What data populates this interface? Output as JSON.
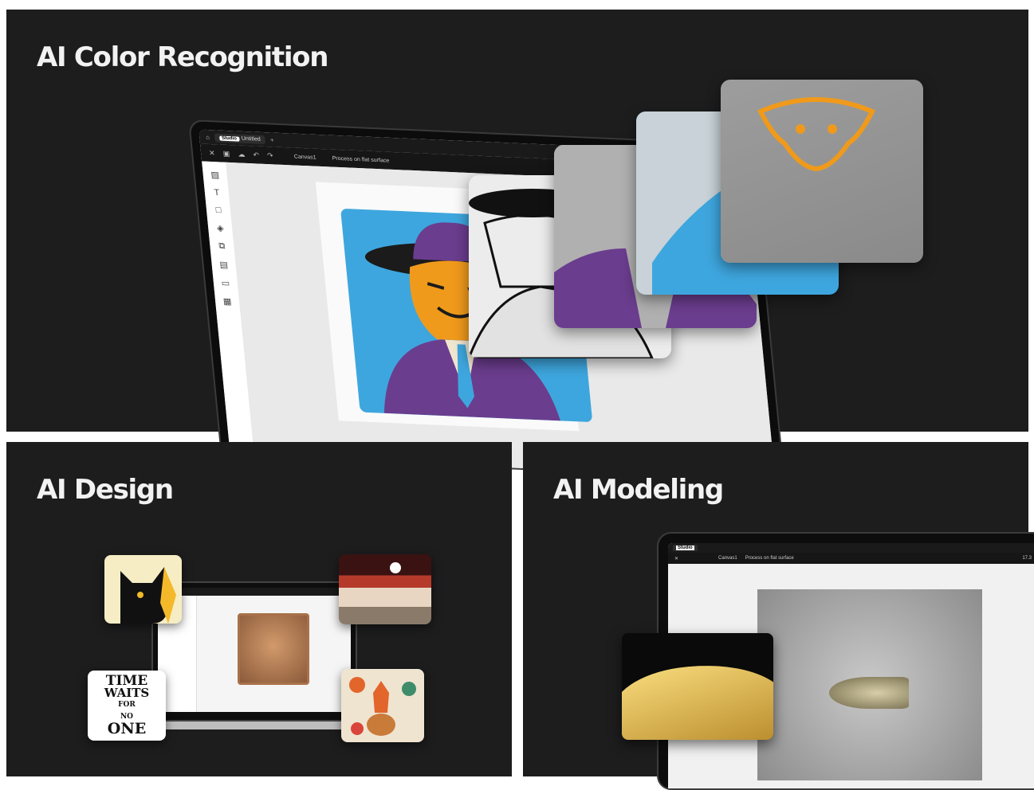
{
  "sections": {
    "color_recognition": {
      "title": "AI Color Recognition"
    },
    "design": {
      "title": "AI Design"
    },
    "modeling": {
      "title": "AI Modeling"
    }
  },
  "app_ui": {
    "tab_badge": "Studio",
    "tab_label": "Untitled",
    "canvas_name": "Canvas1",
    "process_label": "Process on flat surface",
    "zoom": "17.3"
  },
  "design_thumbs": {
    "typography_art": [
      "TIME",
      "WAITS",
      "FOR",
      "NO",
      "ONE"
    ]
  },
  "colors": {
    "panel_bg": "#1d1d1e",
    "title_text": "#f2f2f2",
    "artwork_blue": "#3ea6de",
    "suit_purple": "#6b3d8e",
    "tiger_orange": "#f09a1b"
  },
  "icons": [
    "home-icon",
    "close-icon",
    "save-icon",
    "undo-icon",
    "redo-icon",
    "image-icon",
    "text-icon",
    "shape-icon",
    "pointer-icon"
  ]
}
